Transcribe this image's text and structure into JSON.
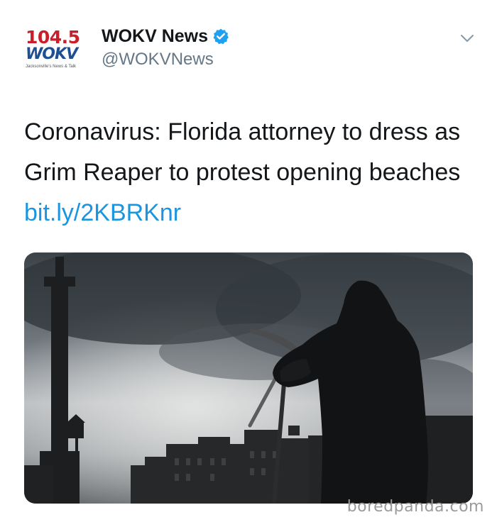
{
  "avatar": {
    "freq": "104.5",
    "station": "WOKV",
    "tagline": "Jacksonville's News & Talk"
  },
  "user": {
    "display_name": "WOKV News",
    "handle": "@WOKVNews",
    "verified": true
  },
  "tweet": {
    "text": "Coronavirus: Florida attorney to dress as Grim Reaper to protest opening beaches",
    "link": "bit.ly/2KBRKnr"
  },
  "icons": {
    "verified": "verified-badge-icon",
    "menu": "chevron-down-icon"
  },
  "colors": {
    "link": "#1b95e0",
    "verified": "#1da1f2",
    "handle": "#657786",
    "brand_red": "#c8202a",
    "brand_blue": "#1f4f93"
  },
  "watermark": "boredpanda.com"
}
